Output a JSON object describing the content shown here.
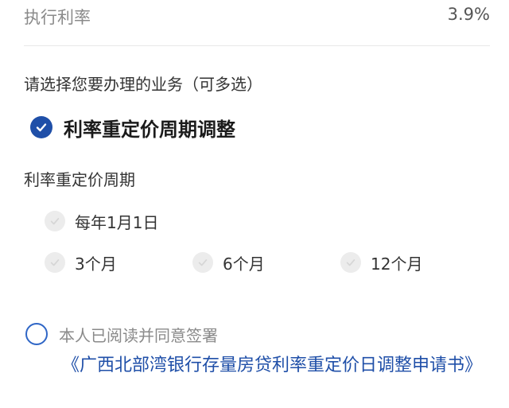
{
  "rate": {
    "label": "执行利率",
    "value": "3.9%"
  },
  "prompt": "请选择您要办理的业务（可多选）",
  "business_option": {
    "label": "利率重定价周期调整",
    "checked": true,
    "icon": "check-circle-icon"
  },
  "period": {
    "title": "利率重定价周期",
    "options": [
      {
        "label": "每年1月1日",
        "icon": "check-circle-icon"
      },
      {
        "label": "3个月",
        "icon": "check-circle-icon"
      },
      {
        "label": "6个月",
        "icon": "check-circle-icon"
      },
      {
        "label": "12个月",
        "icon": "check-circle-icon"
      }
    ]
  },
  "agreement": {
    "label": "本人已阅读并同意签署",
    "doc_link": "《广西北部湾银行存量房贷利率重定价日调整申请书》",
    "icon": "radio-circle-icon"
  },
  "colors": {
    "accent": "#1f4fa8",
    "radio_border": "#2f66c6",
    "muted": "#8a8a8a",
    "disabled_check_bg": "#ececec"
  }
}
